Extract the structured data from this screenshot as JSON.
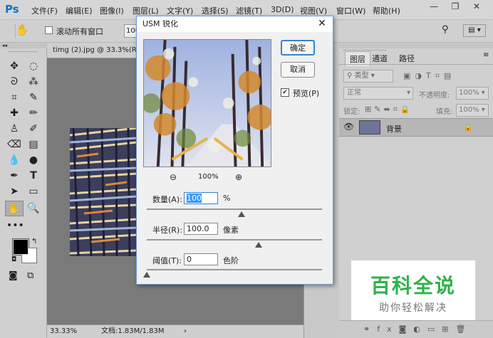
{
  "app": {
    "logo": "Ps"
  },
  "menu": [
    "文件(F)",
    "编辑(E)",
    "图像(I)",
    "图层(L)",
    "文字(Y)",
    "选择(S)",
    "滤镜(T)",
    "3D(D)",
    "视图(V)",
    "窗口(W)",
    "帮助(H)"
  ],
  "window_controls": {
    "minimize": "—",
    "restore": "❐",
    "close": "✕"
  },
  "options": {
    "scroll_all": "滚动所有窗口",
    "field_value": "100"
  },
  "document": {
    "tab": "timg (2).jpg @ 33.3%(RG",
    "zoom": "33.33%",
    "doc_info": "文档:1.83M/1.83M"
  },
  "layers": {
    "tabs": [
      "图层",
      "通道",
      "路径"
    ],
    "kind_label": "类型",
    "blend": "正常",
    "opacity_label": "不透明度:",
    "opacity": "100%",
    "lock_label": "锁定:",
    "fill_label": "填充:",
    "fill": "100%",
    "layer_name": "背景"
  },
  "dialog": {
    "title": "USM 锐化",
    "ok": "确定",
    "reset": "取消",
    "preview_label": "预览(P)",
    "zoom": "100%",
    "amount_label": "数量(A):",
    "amount": "100",
    "amount_unit": "%",
    "radius_label": "半径(R):",
    "radius": "100.0",
    "radius_unit": "像素",
    "threshold_label": "阈值(T):",
    "threshold": "0",
    "threshold_unit": "色阶",
    "amount_level": 0.54,
    "radius_level": 0.64,
    "threshold_level": 0
  },
  "watermark": {
    "title": "百科全说",
    "subtitle": "助你轻松解决"
  },
  "colors": {
    "accent": "#0d74c7",
    "watermark_green": "#2db24a"
  }
}
